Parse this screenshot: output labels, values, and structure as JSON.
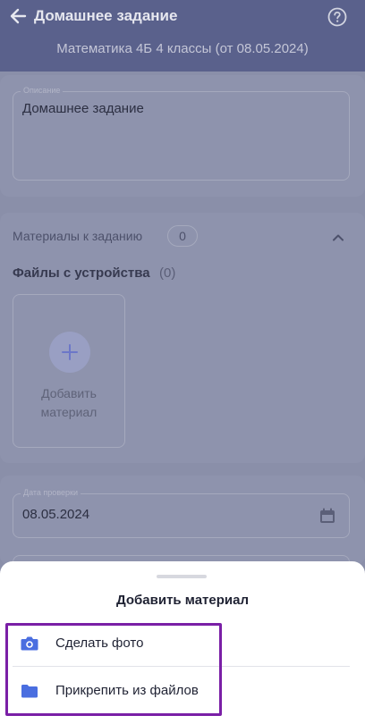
{
  "header": {
    "title": "Домашнее задание",
    "subtitle": "Математика 4Б 4 классы (от 08.05.2024)",
    "back_icon": "arrow-left-icon",
    "help_icon": "question-circle-icon"
  },
  "description": {
    "label": "Описание",
    "value": "Домашнее задание"
  },
  "materials": {
    "heading": "Материалы к заданию",
    "count": "0",
    "collapse_icon": "chevron-up-icon",
    "files_title": "Файлы с устройства",
    "files_count": "(0)",
    "add_label": "Добавить\nматериал",
    "add_icon": "plus-icon"
  },
  "check_date": {
    "label": "Дата проверки",
    "value": "08.05.2024",
    "icon": "calendar-icon"
  },
  "sheet": {
    "title": "Добавить материал",
    "options": [
      {
        "label": "Сделать фото",
        "icon": "camera-icon"
      },
      {
        "label": "Прикрепить из файлов",
        "icon": "folder-icon"
      }
    ]
  },
  "colors": {
    "header": "#5a618c",
    "overlay_background": "#8a8fa9",
    "accent": "#4a6ee0",
    "highlight_border": "#7a1fa6"
  }
}
